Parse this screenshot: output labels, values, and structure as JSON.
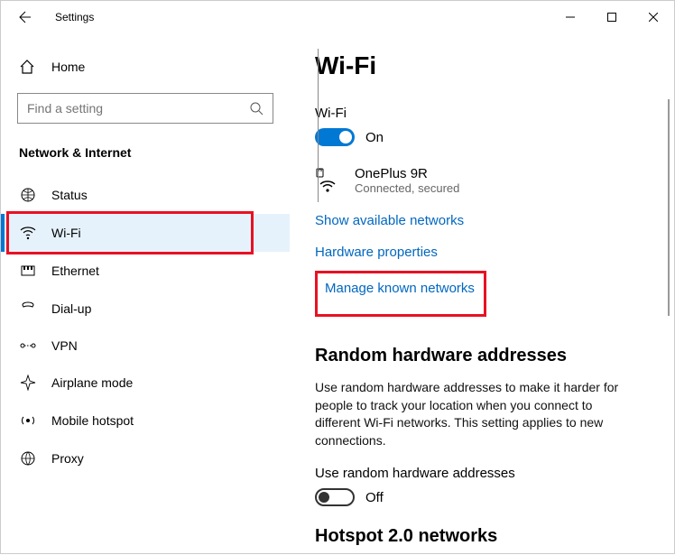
{
  "titlebar": {
    "title": "Settings"
  },
  "sidebar": {
    "home": "Home",
    "search_placeholder": "Find a setting",
    "category": "Network & Internet",
    "items": [
      {
        "label": "Status"
      },
      {
        "label": "Wi-Fi"
      },
      {
        "label": "Ethernet"
      },
      {
        "label": "Dial-up"
      },
      {
        "label": "VPN"
      },
      {
        "label": "Airplane mode"
      },
      {
        "label": "Mobile hotspot"
      },
      {
        "label": "Proxy"
      }
    ]
  },
  "main": {
    "title": "Wi-Fi",
    "wifi_label": "Wi-Fi",
    "wifi_state": "On",
    "network": {
      "name": "OnePlus 9R",
      "status": "Connected, secured"
    },
    "links": {
      "show_available": "Show available networks",
      "hw_props": "Hardware properties",
      "manage_known": "Manage known networks"
    },
    "random": {
      "heading": "Random hardware addresses",
      "desc": "Use random hardware addresses to make it harder for people to track your location when you connect to different Wi-Fi networks. This setting applies to new connections.",
      "toggle_label": "Use random hardware addresses",
      "toggle_state": "Off"
    },
    "hotspot_heading": "Hotspot 2.0 networks"
  }
}
